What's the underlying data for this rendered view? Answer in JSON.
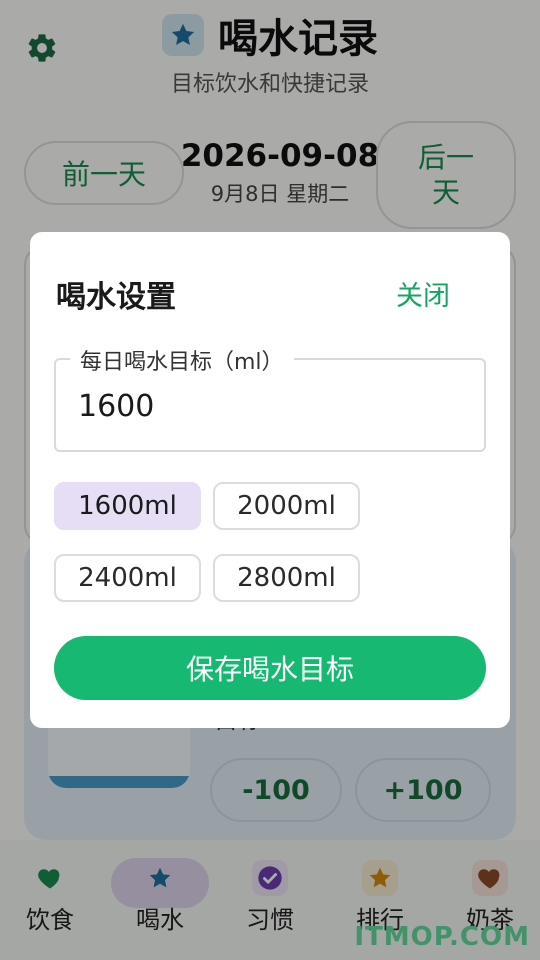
{
  "header": {
    "title": "喝水记录",
    "subtitle": "目标饮水和快捷记录",
    "settings_icon": "gear-icon",
    "title_icon": "star-icon"
  },
  "date_nav": {
    "prev_label": "前一天",
    "next_label_line1": "后一",
    "next_label_line2": "天",
    "date": "2026-09-08",
    "date_sub": "9月8日 星期二"
  },
  "water_card": {
    "target_label": "目标",
    "minus_label": "-100",
    "plus_label": "+100"
  },
  "bottom_nav": {
    "items": [
      {
        "label": "饮食",
        "icon": "heart-icon"
      },
      {
        "label": "喝水",
        "icon": "star-icon"
      },
      {
        "label": "习惯",
        "icon": "check-circle-icon"
      },
      {
        "label": "排行",
        "icon": "star-icon"
      },
      {
        "label": "奶茶",
        "icon": "heart-icon"
      }
    ],
    "active_index": 1
  },
  "watermark": "ITMOP.COM",
  "dialog": {
    "title": "喝水设置",
    "close_label": "关闭",
    "field_label": "每日喝水目标（ml）",
    "field_value": "1600",
    "presets": [
      "1600ml",
      "2000ml",
      "2400ml",
      "2800ml"
    ],
    "selected_preset": "1600ml",
    "save_label": "保存喝水目标"
  },
  "colors": {
    "accent_green": "#17b872",
    "text_green": "#16a462",
    "selected_chip": "#e6def4",
    "water_blue": "#4b9ac8"
  }
}
